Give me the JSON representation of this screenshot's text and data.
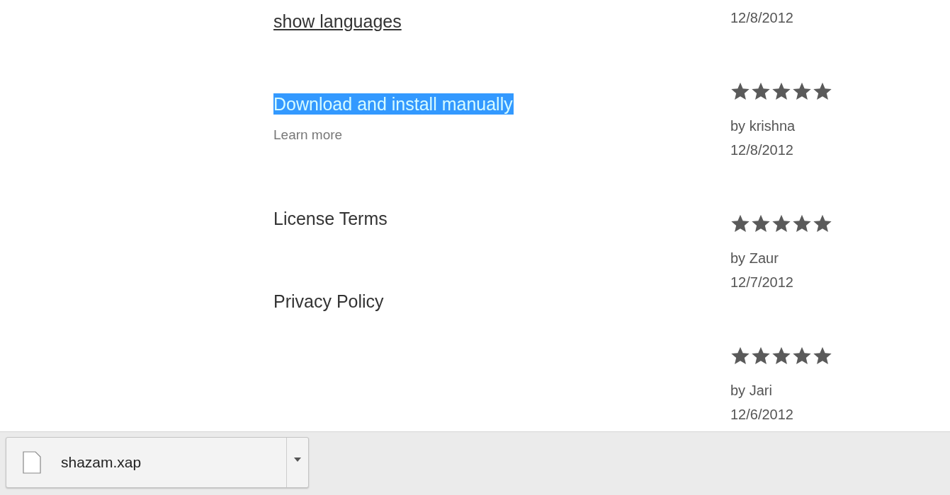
{
  "links": {
    "show_languages": "show languages",
    "download": {
      "label": "Download and install manually",
      "highlighted": true
    },
    "learn_more": "Learn more",
    "license_terms": "License Terms",
    "privacy_policy": "Privacy Policy"
  },
  "reviews_top_date": "12/8/2012",
  "reviews": [
    {
      "stars": 5,
      "author": "by krishna",
      "date": "12/8/2012"
    },
    {
      "stars": 5,
      "author": "by Zaur",
      "date": "12/7/2012"
    },
    {
      "stars": 5,
      "author": "by Jari",
      "date": "12/6/2012"
    }
  ],
  "download_bar": {
    "file_name": "shazam.xap"
  }
}
